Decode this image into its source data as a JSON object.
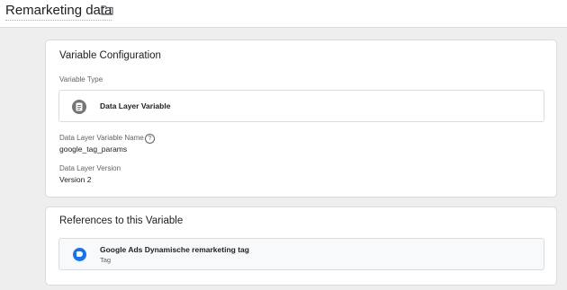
{
  "header": {
    "title": "Remarketing data",
    "folder_icon": "folder-icon"
  },
  "config": {
    "title": "Variable Configuration",
    "variable_type_label": "Variable Type",
    "variable_type_value": "Data Layer Variable",
    "variable_type_icon": "data-layer-variable-icon",
    "dl_name_label": "Data Layer Variable Name",
    "dl_name_value": "google_tag_params",
    "help_icon": "help-icon",
    "dl_version_label": "Data Layer Version",
    "dl_version_value": "Version 2"
  },
  "references": {
    "title": "References to this Variable",
    "items": [
      {
        "name": "Google Ads Dynamische remarketing tag",
        "type": "Tag",
        "icon": "google-ads-tag-icon",
        "icon_color": "#1a73e8"
      }
    ]
  }
}
